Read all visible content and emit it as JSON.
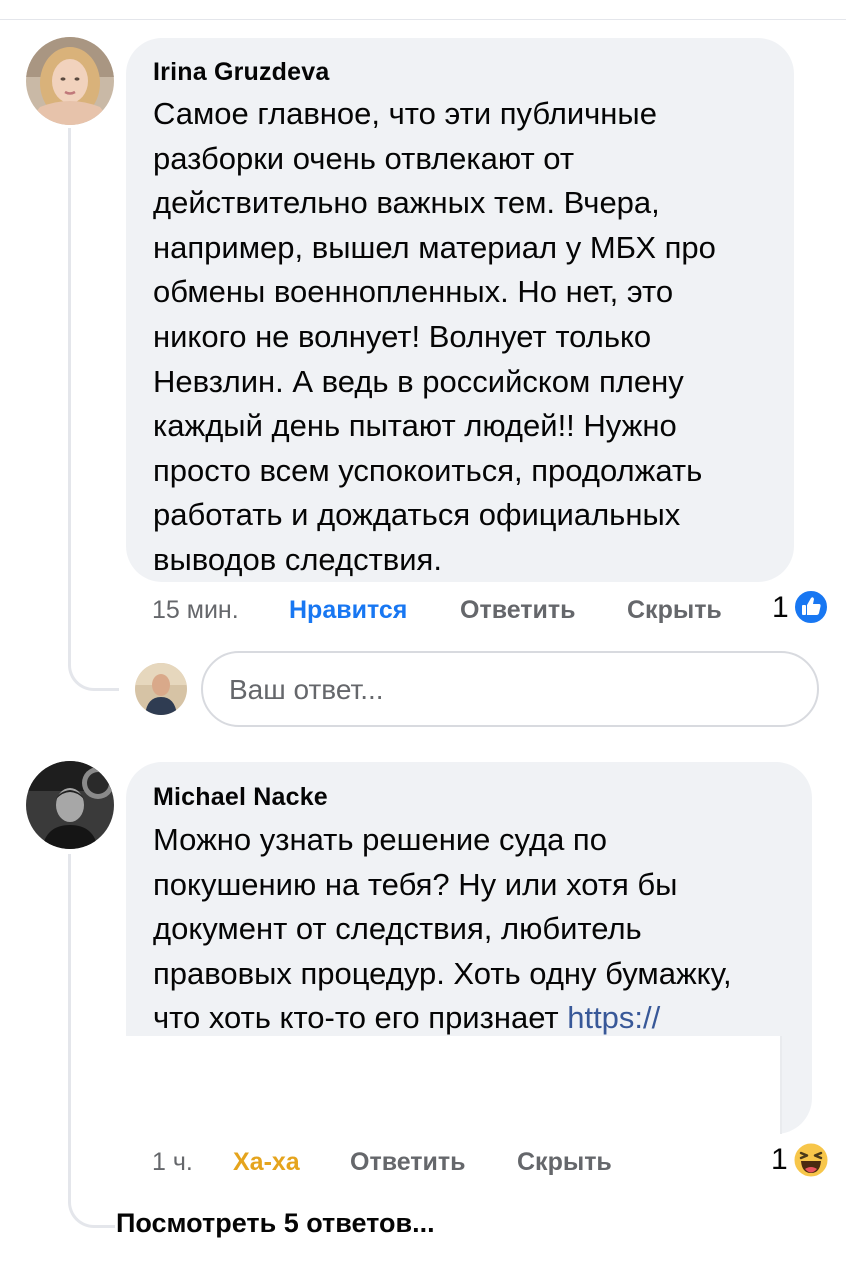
{
  "comments": [
    {
      "author": "Irina Gruzdeva",
      "text_lines": [
        "Самое главное, что эти публичные",
        "разборки очень отвлекают от",
        "действительно важных тем. Вчера,",
        "например,  вышел материал у МБХ про",
        "обмены военнопленных. Но нет, это",
        "никого не волнует! Волнует только",
        "Невзлин. А ведь в российском плену",
        "каждый день пытают людей!!  Нужно",
        "просто всем успокоиться, продолжать",
        "работать  и дождаться официальных",
        "выводов следствия."
      ],
      "time": "15 мин.",
      "like_label": "Нравится",
      "reply_label": "Ответить",
      "hide_label": "Скрыть",
      "reaction_count": "1",
      "reaction_icon": "like-icon",
      "reaction_color": "#1877f2"
    },
    {
      "author": "Michael Nacke",
      "text_lines": [
        "Можно узнать решение суда по",
        "покушению на тебя? Ну или хотя бы",
        "документ от следствия, любитель",
        "правовых процедур. Хоть одну бумажку,",
        "что хоть кто-то его признает "
      ],
      "link_text": "https://",
      "time": "1 ч.",
      "reaction_label": "Ха-ха",
      "reply_label": "Ответить",
      "hide_label": "Скрыть",
      "reaction_count": "1",
      "reaction_icon": "haha-emoji-icon",
      "reaction_color": "#e5a41d"
    }
  ],
  "reply_box": {
    "placeholder": "Ваш ответ..."
  },
  "view_replies_label": "Посмотреть 5 ответов...",
  "colors": {
    "bubble": "#f0f2f5",
    "secondary_text": "#65676b",
    "link": "#385898",
    "like_blue": "#1877f2",
    "haha_yellow": "#e5a41d"
  }
}
